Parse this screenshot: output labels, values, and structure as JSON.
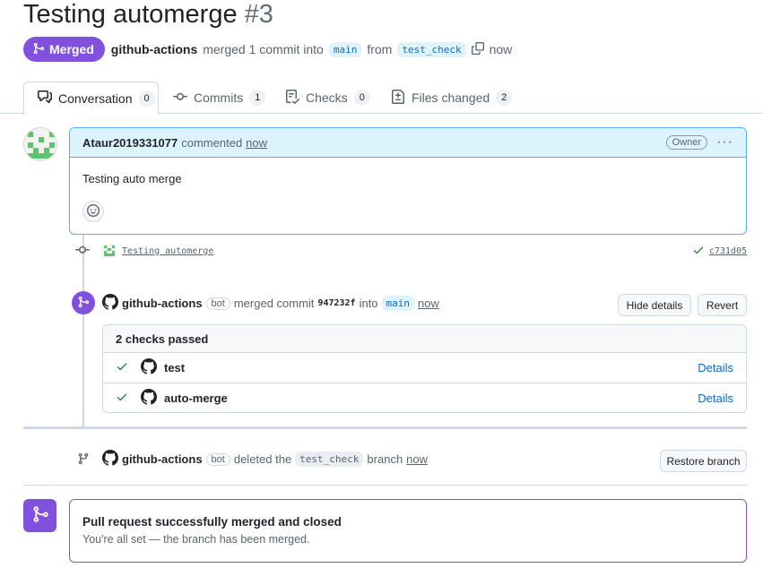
{
  "pr": {
    "title": "Testing automerge",
    "number": "#3",
    "state": "Merged",
    "author": "github-actions",
    "merged_text": "merged 1 commit into",
    "base_branch": "main",
    "from_text": "from",
    "head_branch": "test_check",
    "time": "now"
  },
  "tabs": [
    {
      "label": "Conversation",
      "count": "0",
      "icon": "comment-discussion-icon"
    },
    {
      "label": "Commits",
      "count": "1",
      "icon": "git-commit-icon"
    },
    {
      "label": "Checks",
      "count": "0",
      "icon": "checklist-icon"
    },
    {
      "label": "Files changed",
      "count": "2",
      "icon": "file-diff-icon"
    }
  ],
  "comment": {
    "author": "Ataur2019331077",
    "action": "commented",
    "time": "now",
    "role": "Owner",
    "menu": "···",
    "body": "Testing auto merge"
  },
  "commit": {
    "message": "Testing automerge",
    "sha": "c731d05"
  },
  "merge_event": {
    "actor": "github-actions",
    "bot_label": "bot",
    "action": "merged commit",
    "sha": "947232f",
    "into_text": "into",
    "branch": "main",
    "time": "now",
    "hide_details": "Hide details",
    "revert": "Revert"
  },
  "checks": {
    "summary": "2 checks passed",
    "items": [
      {
        "name": "test",
        "details": "Details"
      },
      {
        "name": "auto-merge",
        "details": "Details"
      }
    ]
  },
  "delete_event": {
    "actor": "github-actions",
    "bot_label": "bot",
    "action": "deleted the",
    "branch": "test_check",
    "suffix": "branch",
    "time": "now",
    "restore": "Restore branch"
  },
  "merged_box": {
    "title": "Pull request successfully merged and closed",
    "subtitle": "You're all set — the branch has been merged."
  },
  "colors": {
    "merged_purple": "#8250df",
    "link_blue": "#0969da",
    "success_green": "#1a7f37",
    "comment_header_bg": "#ddf4ff"
  }
}
